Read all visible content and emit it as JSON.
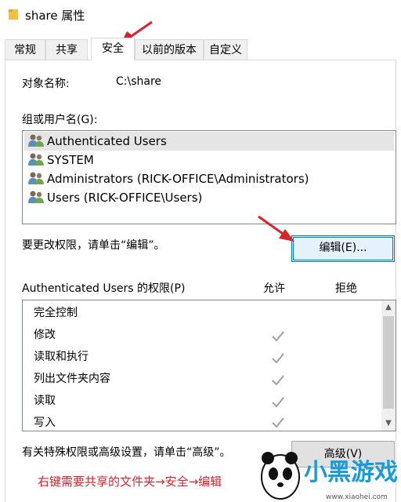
{
  "window": {
    "title": "share 属性"
  },
  "tabs": [
    {
      "label": "常规"
    },
    {
      "label": "共享"
    },
    {
      "label": "安全"
    },
    {
      "label": "以前的版本"
    },
    {
      "label": "自定义"
    }
  ],
  "object": {
    "label": "对象名称:",
    "value": "C:\\share"
  },
  "groups": {
    "label": "组或用户名(G):",
    "users": [
      {
        "name": "Authenticated Users",
        "selected": true
      },
      {
        "name": "SYSTEM",
        "selected": false
      },
      {
        "name": "Administrators (RICK-OFFICE\\Administrators)",
        "selected": false
      },
      {
        "name": "Users (RICK-OFFICE\\Users)",
        "selected": false
      }
    ]
  },
  "change_hint": "要更改权限，请单击“编辑”。",
  "edit_button": "编辑(E)...",
  "permissions": {
    "header": "Authenticated Users 的权限(P)",
    "allow_label": "允许",
    "deny_label": "拒绝",
    "items": [
      {
        "name": "完全控制",
        "allow": false
      },
      {
        "name": "修改",
        "allow": true
      },
      {
        "name": "读取和执行",
        "allow": true
      },
      {
        "name": "列出文件夹内容",
        "allow": true
      },
      {
        "name": "读取",
        "allow": true
      },
      {
        "name": "写入",
        "allow": true
      }
    ]
  },
  "advanced_hint": "有关特殊权限或高级设置，请单击“高级”。",
  "advanced_button": "高级(V)",
  "caption": "右键需要共享的文件夹→安全→编辑",
  "watermark": {
    "brand": "小黑游戏",
    "url": "www.xiaohei.com"
  },
  "colors": {
    "accent": "#0078d7",
    "annotation": "#d9232c",
    "check": "#a0a0a0"
  }
}
